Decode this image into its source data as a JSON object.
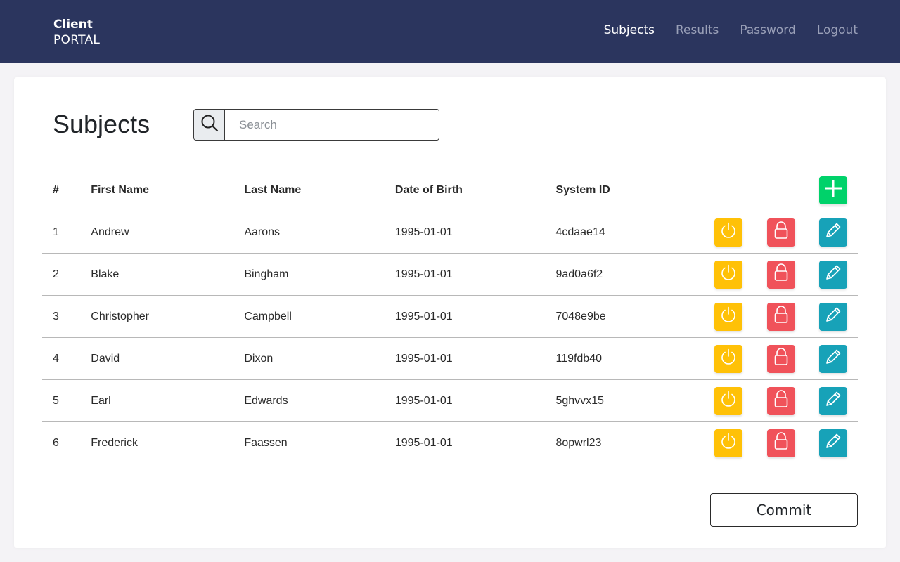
{
  "header": {
    "brand_line1": "Client",
    "brand_line2": "PORTAL",
    "nav": [
      {
        "label": "Subjects",
        "active": true
      },
      {
        "label": "Results",
        "active": false
      },
      {
        "label": "Password",
        "active": false
      },
      {
        "label": "Logout",
        "active": false
      }
    ],
    "background_color": "#2b355e"
  },
  "main": {
    "title": "Subjects",
    "search": {
      "placeholder": "Search",
      "value": "",
      "icon": "search-icon"
    },
    "table": {
      "columns": [
        "#",
        "First Name",
        "Last Name",
        "Date of Birth",
        "System ID"
      ],
      "add_icon": "plus-icon",
      "row_action_icons": [
        "power-icon",
        "lock-icon",
        "pencil-icon"
      ],
      "rows": [
        {
          "num": "1",
          "first": "Andrew",
          "last": "Aarons",
          "dob": "1995-01-01",
          "system_id": "4cdaae14"
        },
        {
          "num": "2",
          "first": "Blake",
          "last": "Bingham",
          "dob": "1995-01-01",
          "system_id": "9ad0a6f2"
        },
        {
          "num": "3",
          "first": "Christopher",
          "last": "Campbell",
          "dob": "1995-01-01",
          "system_id": "7048e9be"
        },
        {
          "num": "4",
          "first": "David",
          "last": "Dixon",
          "dob": "1995-01-01",
          "system_id": "119fdb40"
        },
        {
          "num": "5",
          "first": "Earl",
          "last": "Edwards",
          "dob": "1995-01-01",
          "system_id": "5ghvvx15"
        },
        {
          "num": "6",
          "first": "Frederick",
          "last": "Faassen",
          "dob": "1995-01-01",
          "system_id": "8opwrl23"
        }
      ]
    },
    "commit_label": "Commit"
  },
  "colors": {
    "power": "#ffc107",
    "lock": "#f0525a",
    "edit": "#17a2b8",
    "add": "#00d26a"
  }
}
